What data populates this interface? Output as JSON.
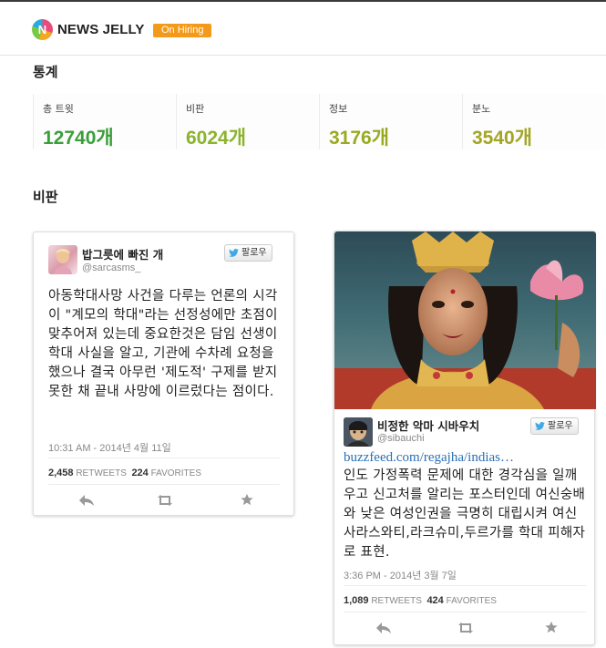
{
  "brand": {
    "name": "NEWS JELLY",
    "hiring_badge": "On Hiring"
  },
  "stats_section": {
    "title": "통계"
  },
  "stats": [
    {
      "label": "총 트윗",
      "value": "12740개",
      "color": "#3a9e3a"
    },
    {
      "label": "비판",
      "value": "6024개",
      "color": "#8bb32d"
    },
    {
      "label": "정보",
      "value": "3176개",
      "color": "#9aaa20"
    },
    {
      "label": "분노",
      "value": "3540개",
      "color": "#a3a524"
    }
  ],
  "critique_section": {
    "title": "비판"
  },
  "tweets": [
    {
      "name": "밥그릇에 빠진 개",
      "handle": "@sarcasms_",
      "follow_label": "팔로우",
      "text": "아동학대사망 사건을 다루는 언론의 시각이 \"계모의 학대\"라는 선정성에만 초점이 맞추어져 있는데 중요한것은 담임 선생이 학대 사실을 알고, 기관에 수차례 요청을 했으나 결국 아무런 '제도적' 구제를 받지 못한 채 끝내 사망에 이르렀다는 점이다.",
      "time": "10:31 AM - 2014년 4월 11일",
      "retweets": "2,458",
      "retweets_label": "RETWEETS",
      "favorites": "224",
      "favorites_label": "FAVORITES"
    },
    {
      "name": "비정한 악마 시바우치",
      "handle": "@sibauchi",
      "follow_label": "팔로우",
      "link": "buzzfeed.com/regajha/indias…",
      "text": "인도 가정폭력 문제에 대한 경각심을 일깨우고 신고처를 알리는 포스터인데 여신숭배와 낮은 여성인권을 극명히 대립시켜 여신 사라스와티,라크슈미,두르가를 학대 피해자로 표현.",
      "time": "3:36 PM - 2014년 3월 7일",
      "retweets": "1,089",
      "retweets_label": "RETWEETS",
      "favorites": "424",
      "favorites_label": "FAVORITES"
    }
  ],
  "icons": {
    "reply": "reply-icon",
    "retweet": "retweet-icon",
    "favorite": "star-icon",
    "twitter": "twitter-bird-icon"
  }
}
